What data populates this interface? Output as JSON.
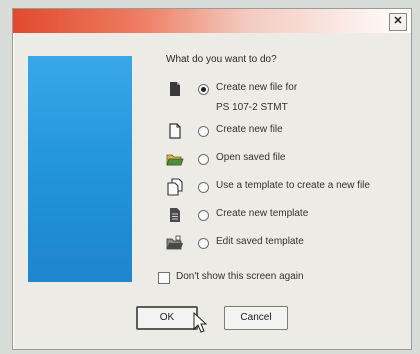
{
  "window": {
    "title": ""
  },
  "dialog": {
    "prompt": "What do you want to do?",
    "options": [
      {
        "label": "Create new file for",
        "checked": true,
        "icon": "filled-document-icon"
      },
      {
        "label": "Create new file",
        "checked": false,
        "icon": "blank-document-icon"
      },
      {
        "label": "Open saved file",
        "checked": false,
        "icon": "open-folder-icon"
      },
      {
        "label": "Use a template to create a new file",
        "checked": false,
        "icon": "template-document-icon"
      },
      {
        "label": "Create new template",
        "checked": false,
        "icon": "new-template-icon"
      },
      {
        "label": "Edit saved template",
        "checked": false,
        "icon": "edit-template-icon"
      }
    ],
    "option_sublabel": "PS 107-2 STMT",
    "dont_show_label": "Don't show this screen again",
    "ok_label": "OK",
    "cancel_label": "Cancel"
  },
  "colors": {
    "title_gradient_start": "#e14a2c",
    "banner": "#2294da",
    "window_bg": "#ecebe6"
  }
}
